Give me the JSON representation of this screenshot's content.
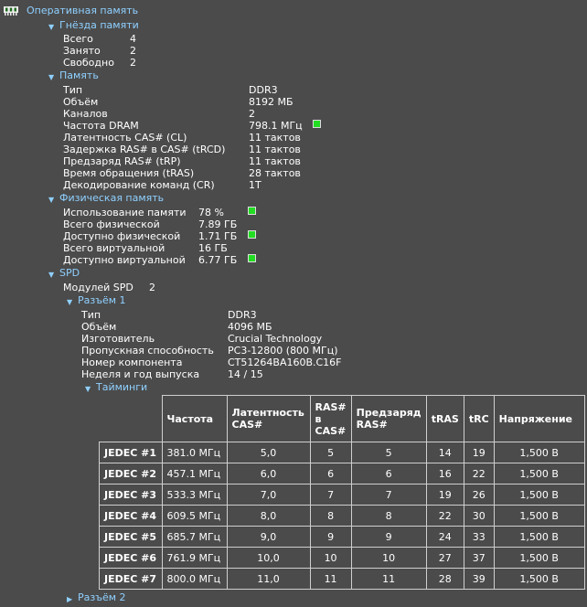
{
  "root": {
    "title": "Оперативная память"
  },
  "slots": {
    "title": "Гнёзда памяти",
    "rows": [
      {
        "label": "Всего",
        "value": "4"
      },
      {
        "label": "Занято",
        "value": "2"
      },
      {
        "label": "Свободно",
        "value": "2"
      }
    ]
  },
  "memory": {
    "title": "Память",
    "rows": [
      {
        "label": "Тип",
        "value": "DDR3"
      },
      {
        "label": "Объём",
        "value": "8192 МБ"
      },
      {
        "label": "Каналов",
        "value": "2"
      },
      {
        "label": "Частота DRAM",
        "value": "798.1 МГц"
      },
      {
        "label": "Латентность CAS# (CL)",
        "value": "11 тактов"
      },
      {
        "label": "Задержка RAS# в CAS# (tRCD)",
        "value": "11 тактов"
      },
      {
        "label": "Предзаряд RAS# (tRP)",
        "value": "11 тактов"
      },
      {
        "label": "Время обращения (tRAS)",
        "value": "28 тактов"
      },
      {
        "label": "Декодирование команд (CR)",
        "value": "1T"
      }
    ]
  },
  "physical": {
    "title": "Физическая память",
    "rows": [
      {
        "label": "Использование памяти",
        "value": "78 %"
      },
      {
        "label": "Всего физической",
        "value": "7.89 ГБ"
      },
      {
        "label": "Доступно физической",
        "value": "1.71 ГБ"
      },
      {
        "label": "Всего виртуальной",
        "value": "16 ГБ"
      },
      {
        "label": "Доступно виртуальной",
        "value": "6.77 ГБ"
      }
    ]
  },
  "spd": {
    "title": "SPD",
    "modules_label": "Модулей SPD",
    "modules_value": "2",
    "slot1": {
      "title": "Разъём 1",
      "rows": [
        {
          "label": "Тип",
          "value": "DDR3"
        },
        {
          "label": "Объём",
          "value": "4096 МБ"
        },
        {
          "label": "Изготовитель",
          "value": "Crucial Technology"
        },
        {
          "label": "Пропускная способность",
          "value": "PC3-12800 (800 МГц)"
        },
        {
          "label": "Номер компонента",
          "value": "CT51264BA160B.C16F"
        },
        {
          "label": "Неделя и год выпуска",
          "value": "14 / 15"
        }
      ],
      "timings": {
        "title": "Тайминги",
        "headers": [
          "Частота",
          "Латентность CAS#",
          "RAS# в CAS#",
          "Предзаряд RAS#",
          "tRAS",
          "tRC",
          "Напряжение"
        ],
        "rows": [
          {
            "name": "JEDEC #1",
            "cells": [
              "381.0 МГц",
              "5,0",
              "5",
              "5",
              "14",
              "19",
              "1,500 В"
            ]
          },
          {
            "name": "JEDEC #2",
            "cells": [
              "457.1 МГц",
              "6,0",
              "6",
              "6",
              "16",
              "22",
              "1,500 В"
            ]
          },
          {
            "name": "JEDEC #3",
            "cells": [
              "533.3 МГц",
              "7,0",
              "7",
              "7",
              "19",
              "26",
              "1,500 В"
            ]
          },
          {
            "name": "JEDEC #4",
            "cells": [
              "609.5 МГц",
              "8,0",
              "8",
              "8",
              "22",
              "30",
              "1,500 В"
            ]
          },
          {
            "name": "JEDEC #5",
            "cells": [
              "685.7 МГц",
              "9,0",
              "9",
              "9",
              "24",
              "33",
              "1,500 В"
            ]
          },
          {
            "name": "JEDEC #6",
            "cells": [
              "761.9 МГц",
              "10,0",
              "10",
              "10",
              "27",
              "37",
              "1,500 В"
            ]
          },
          {
            "name": "JEDEC #7",
            "cells": [
              "800.0 МГц",
              "11,0",
              "11",
              "11",
              "28",
              "39",
              "1,500 В"
            ]
          }
        ]
      }
    },
    "slot2": {
      "title": "Разъём 2"
    }
  },
  "colors": {
    "background": "#4b4b4b",
    "header": "#8fd0ff",
    "indicator": "#22dd22"
  }
}
